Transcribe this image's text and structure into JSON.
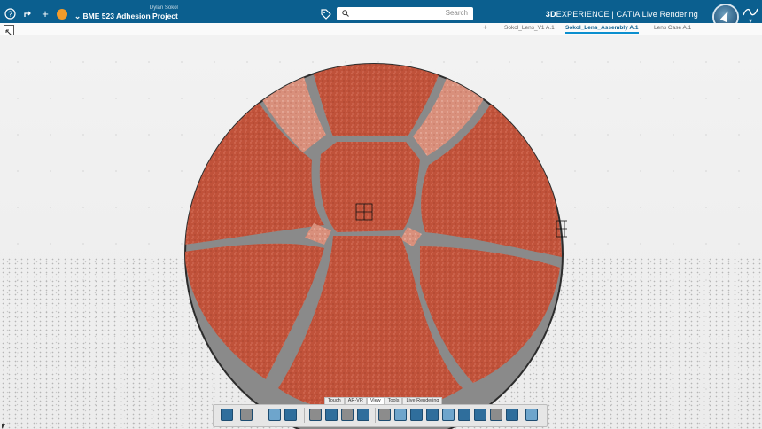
{
  "header": {
    "project_owner": "Dylan Sokol",
    "project_name": "BME 523 Adhesion Project",
    "search_placeholder": "Search",
    "brand_bold": "3D",
    "brand_rest": "EXPERIENCE | CATIA  Live Rendering"
  },
  "tabs": [
    {
      "label": "Lens Case A.1"
    },
    {
      "label": "Sokol_Lens_Assembly A.1",
      "active": true
    },
    {
      "label": "Sokol_Lens_V1 A.1"
    }
  ],
  "action_bar": {
    "tabs": [
      "Touch",
      "AR-VR",
      "View",
      "Tools",
      "Live Rendering"
    ],
    "active_tab": "View"
  },
  "colors": {
    "header_bg": "#0b5f8f",
    "model_fill": "#c0523a",
    "model_light": "#d9907c",
    "seam": "#8a8a8a",
    "accent": "#f39b2a"
  }
}
